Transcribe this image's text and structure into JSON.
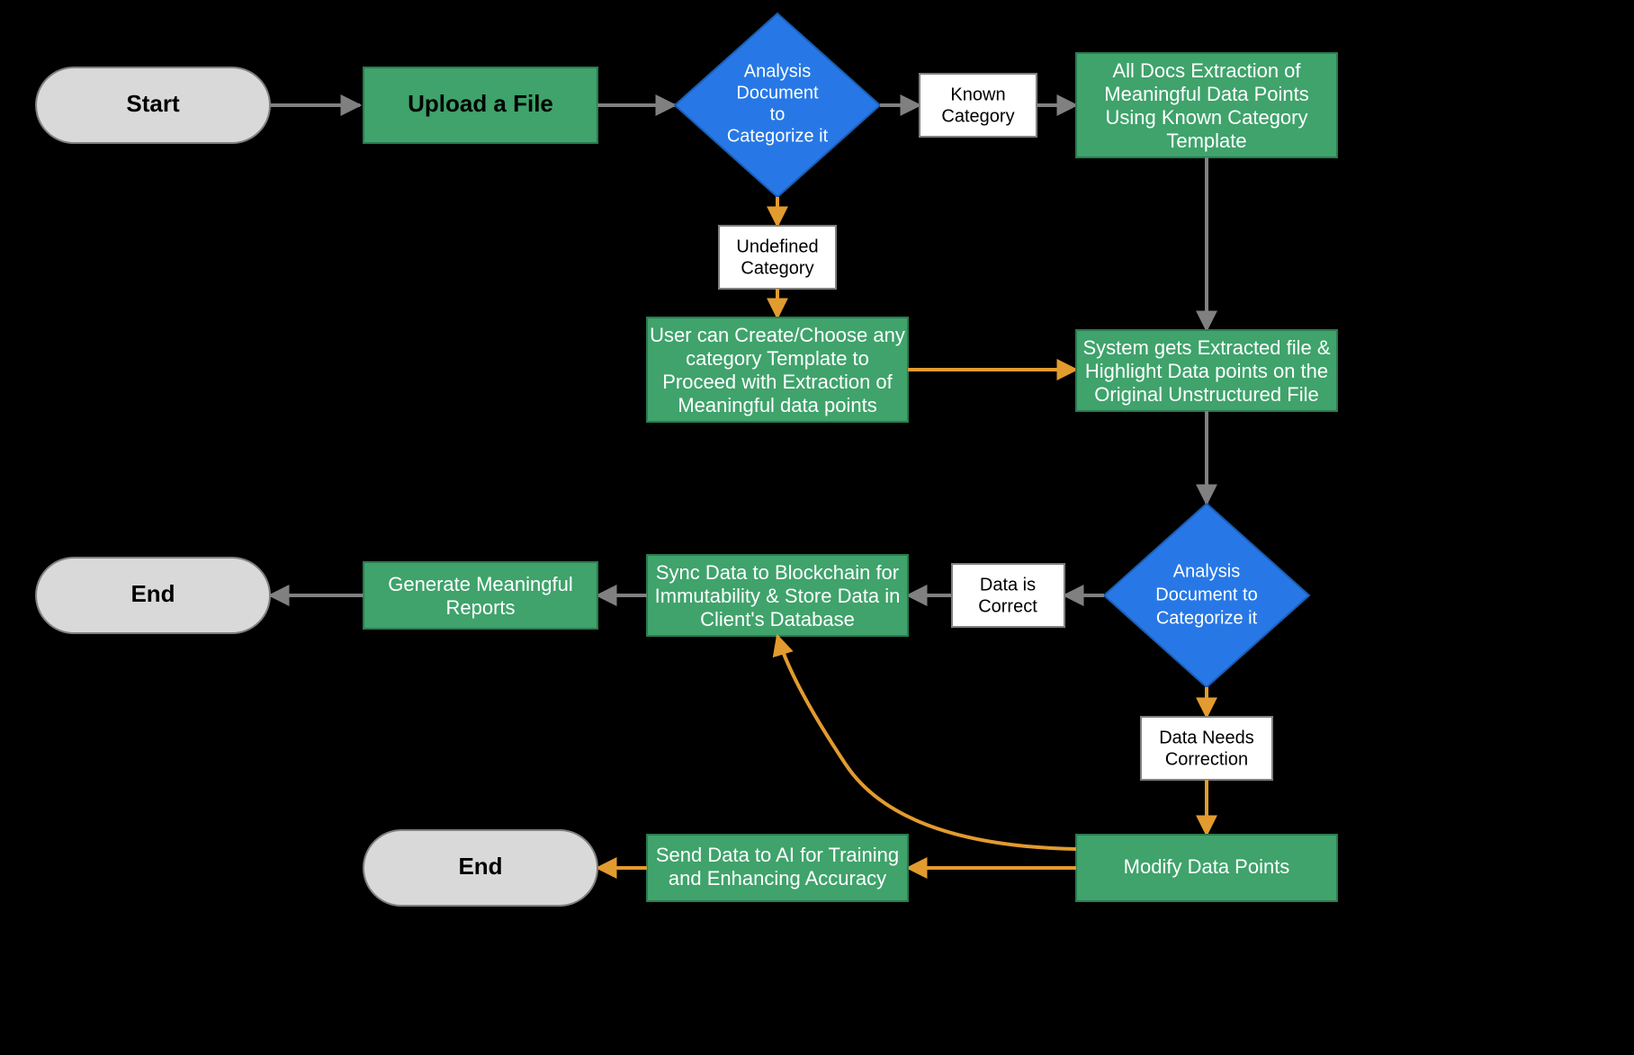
{
  "colors": {
    "terminator": "#d9d9d9",
    "process": "#3fa36b",
    "decision": "#2778e6",
    "labelbox": "#ffffff",
    "arrow_gray": "#808080",
    "arrow_orange": "#e29b2e"
  },
  "nodes": {
    "start": "Start",
    "upload": "Upload a File",
    "decision1_l1": "Analysis",
    "decision1_l2": "Document",
    "decision1_l3": "to",
    "decision1_l4": "Categorize it",
    "known_l1": "Known",
    "known_l2": "Category",
    "undefined_l1": "Undefined",
    "undefined_l2": "Category",
    "extract_l1": "All Docs Extraction of",
    "extract_l2": "Meaningful Data Points",
    "extract_l3": "Using Known Category",
    "extract_l4": "Template",
    "usercreate_l1": "User can Create/Choose any",
    "usercreate_l2": "category Template to",
    "usercreate_l3": "Proceed with Extraction of",
    "usercreate_l4": "Meaningful data points",
    "highlight_l1": "System gets Extracted file &",
    "highlight_l2": "Highlight Data points on the",
    "highlight_l3": "Original Unstructured File",
    "decision2_l1": "Analysis",
    "decision2_l2": "Document to",
    "decision2_l3": "Categorize it",
    "correct_l1": "Data is",
    "correct_l2": "Correct",
    "needs_l1": "Data Needs",
    "needs_l2": "Correction",
    "modify": "Modify Data Points",
    "sync_l1": "Sync Data to Blockchain for",
    "sync_l2": "Immutability & Store Data in",
    "sync_l3": "Client's Database",
    "reports_l1": "Generate Meaningful",
    "reports_l2": "Reports",
    "ai_l1": "Send Data to AI for Training",
    "ai_l2": "and Enhancing Accuracy",
    "end1": "End",
    "end2": "End"
  }
}
